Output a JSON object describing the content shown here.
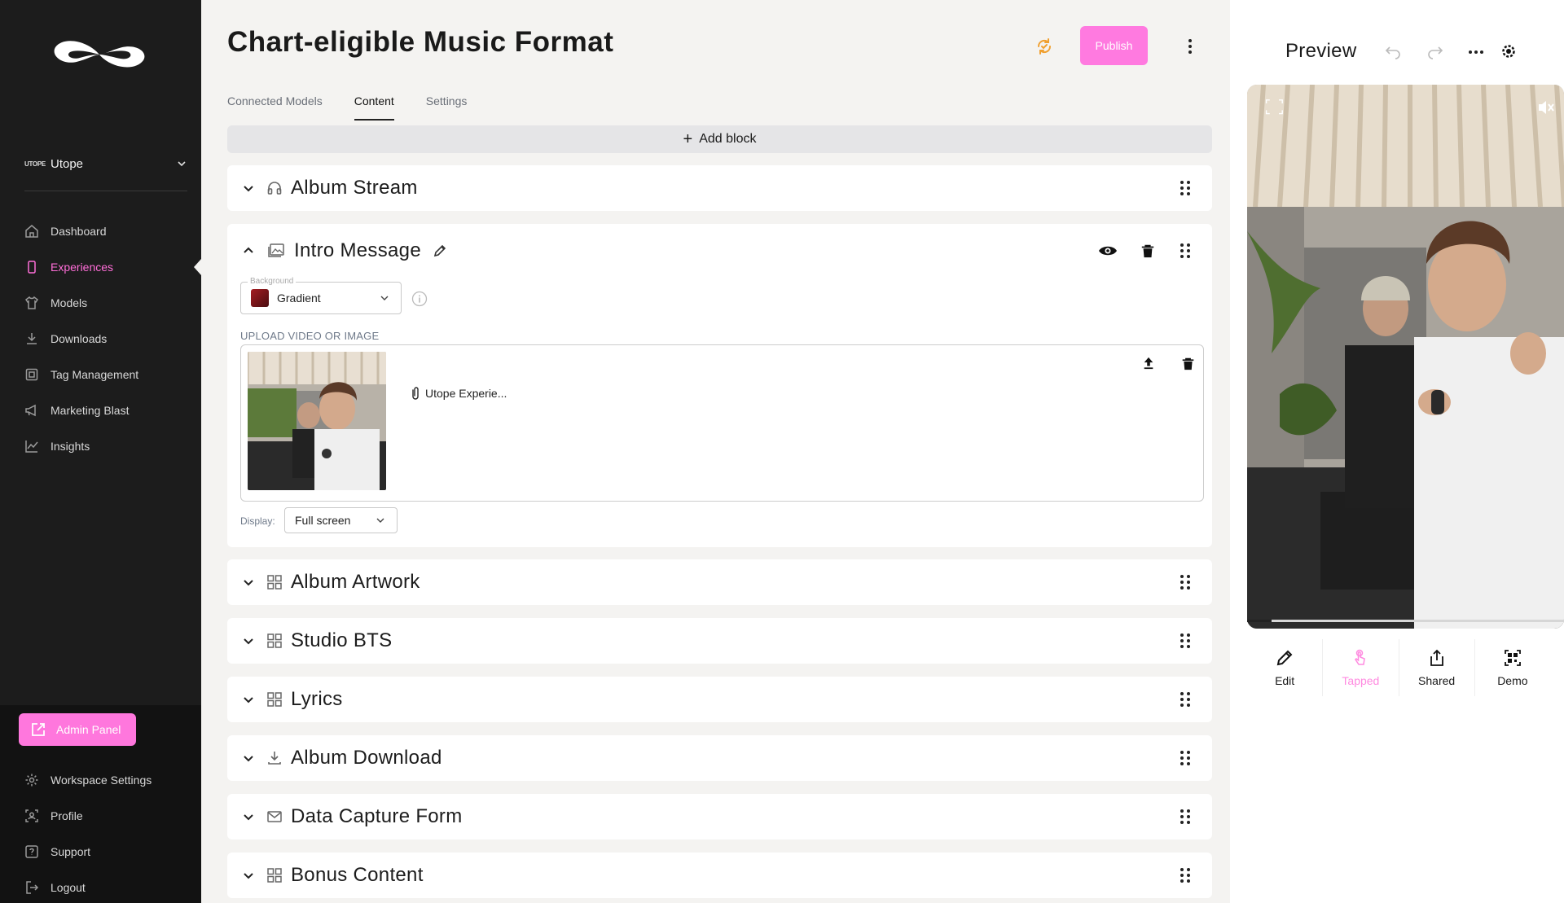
{
  "sidebar": {
    "workspace": {
      "mark": "UTOPE",
      "name": "Utope"
    },
    "nav": [
      {
        "label": "Dashboard",
        "icon": "home-icon"
      },
      {
        "label": "Experiences",
        "icon": "phone-icon",
        "active": true
      },
      {
        "label": "Models",
        "icon": "shirt-icon"
      },
      {
        "label": "Downloads",
        "icon": "download-icon"
      },
      {
        "label": "Tag Management",
        "icon": "tag-icon"
      },
      {
        "label": "Marketing Blast",
        "icon": "megaphone-icon"
      },
      {
        "label": "Insights",
        "icon": "chart-icon"
      }
    ],
    "admin_label": "Admin Panel",
    "bottom_nav": [
      {
        "label": "Workspace Settings",
        "icon": "gear-icon"
      },
      {
        "label": "Profile",
        "icon": "profile-icon"
      },
      {
        "label": "Support",
        "icon": "help-icon"
      },
      {
        "label": "Logout",
        "icon": "logout-icon"
      }
    ]
  },
  "header": {
    "title": "Chart-eligible Music Format",
    "publish_label": "Publish"
  },
  "tabs": [
    {
      "label": "Connected Models"
    },
    {
      "label": "Content",
      "active": true
    },
    {
      "label": "Settings"
    }
  ],
  "add_block_label": "Add block",
  "blocks": {
    "album_stream": "Album Stream",
    "intro_message": "Intro Message",
    "album_artwork": "Album Artwork",
    "studio_bts": "Studio BTS",
    "lyrics": "Lyrics",
    "album_download": "Album Download",
    "data_capture": "Data Capture Form",
    "bonus": "Bonus Content"
  },
  "intro": {
    "background_legend": "Background",
    "background_value": "Gradient",
    "upload_label": "UPLOAD VIDEO OR IMAGE",
    "file_name": "Utope Experie...",
    "display_label": "Display:",
    "display_value": "Full screen"
  },
  "preview": {
    "title": "Preview",
    "actions": [
      {
        "label": "Edit",
        "icon": "pencil-icon"
      },
      {
        "label": "Tapped",
        "icon": "tap-icon",
        "active": true
      },
      {
        "label": "Shared",
        "icon": "share-icon"
      },
      {
        "label": "Demo",
        "icon": "qr-icon"
      }
    ]
  },
  "colors": {
    "accent": "#ff77dd",
    "sidebar_bg": "#1c1c1c",
    "page_bg": "#f4f3f1",
    "sync_icon": "#f0a030"
  }
}
